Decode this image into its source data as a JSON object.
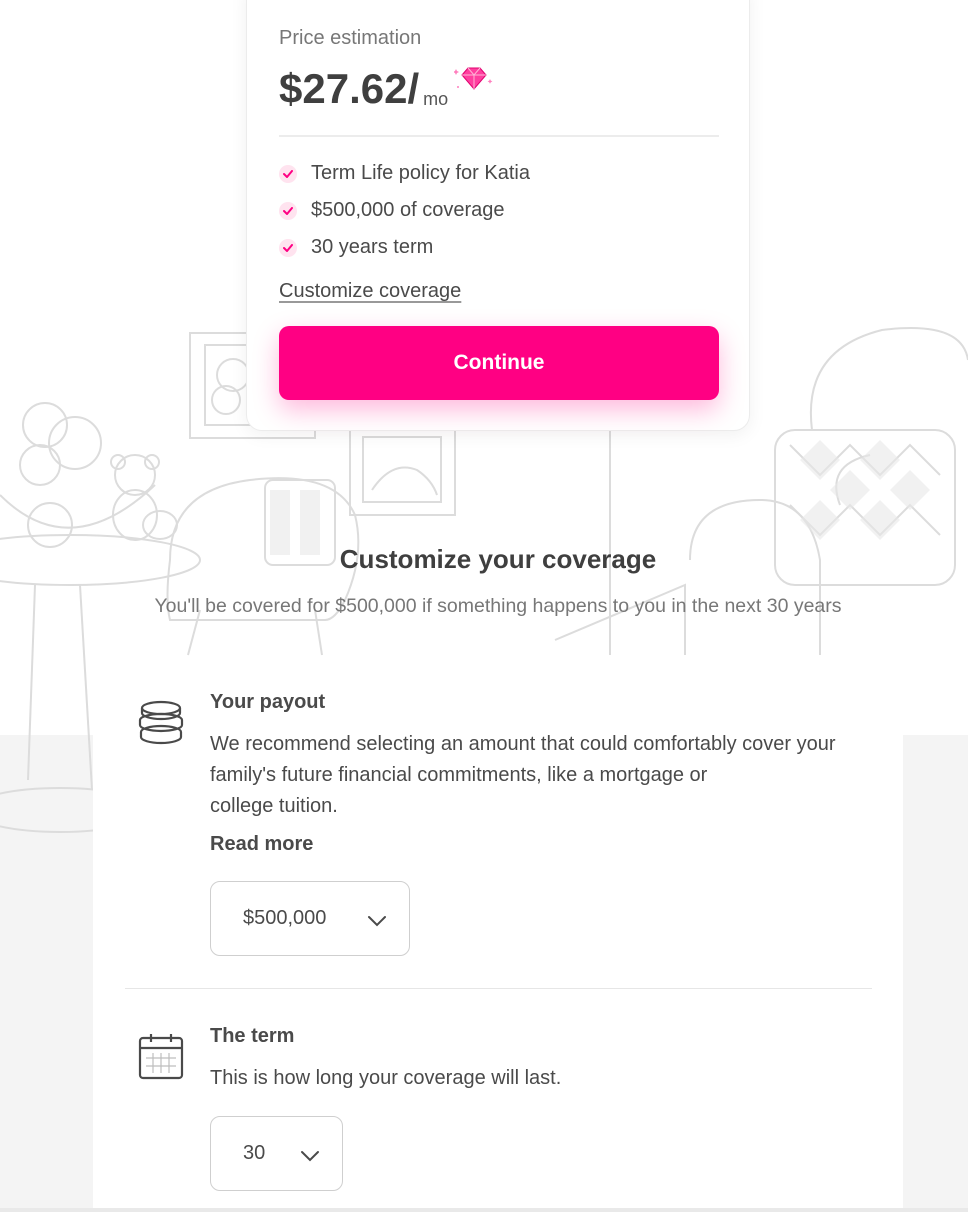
{
  "price_card": {
    "label": "Price estimation",
    "amount": "$27.62/",
    "unit": "mo",
    "features": [
      "Term Life policy for Katia",
      "$500,000 of coverage",
      "30 years term"
    ],
    "customize_link": "Customize coverage",
    "continue_label": "Continue"
  },
  "customize": {
    "title": "Customize your coverage",
    "subtitle": "You'll be covered for $500,000 if something happens to you in the next 30 years"
  },
  "payout": {
    "title": "Your payout",
    "description_lines": [
      "We recommend selecting an amount that could comfortably cover your",
      "family's future financial commitments, like a mortgage or",
      "college tuition."
    ],
    "read_more": "Read more",
    "selected": "$500,000",
    "icon": "coins-stack-icon"
  },
  "term": {
    "title": "The term",
    "description": "This is how long your coverage will last.",
    "selected": "30",
    "icon": "calendar-icon"
  },
  "colors": {
    "accent": "#ff0083",
    "check_bg": "#ffe3ef",
    "text": "#4a4a4a",
    "muted": "#777777"
  }
}
